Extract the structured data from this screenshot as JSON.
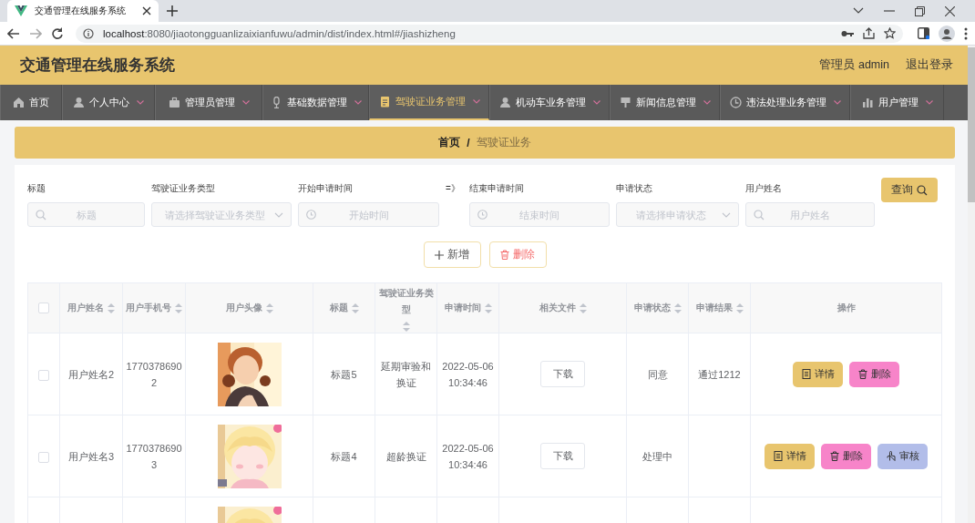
{
  "browser": {
    "tab_title": "交通管理在线服务系统",
    "url_host": "localhost",
    "url_rest": ":8080/jiaotongguanlizaixianfuwu/admin/dist/index.html#/jiashizheng"
  },
  "header": {
    "title": "交通管理在线服务系统",
    "user": "管理员 admin",
    "logout": "退出登录"
  },
  "nav": [
    {
      "label": "首页",
      "selected": false,
      "has_menu": false
    },
    {
      "label": "个人中心",
      "selected": false,
      "has_menu": true
    },
    {
      "label": "管理员管理",
      "selected": false,
      "has_menu": true
    },
    {
      "label": "基础数据管理",
      "selected": false,
      "has_menu": true
    },
    {
      "label": "驾驶证业务管理",
      "selected": true,
      "has_menu": true
    },
    {
      "label": "机动车业务管理",
      "selected": false,
      "has_menu": true
    },
    {
      "label": "新闻信息管理",
      "selected": false,
      "has_menu": true
    },
    {
      "label": "违法处理业务管理",
      "selected": false,
      "has_menu": true
    },
    {
      "label": "用户管理",
      "selected": false,
      "has_menu": true
    }
  ],
  "breadcrumb": [
    {
      "label": "首页",
      "current": false
    },
    {
      "label": "驾驶证业务",
      "current": true
    }
  ],
  "breadcrumb_separator": "/",
  "filters": [
    {
      "kind": "search",
      "label": "标题",
      "placeholder": "标题"
    },
    {
      "kind": "select",
      "label": "驾驶证业务类型",
      "placeholder": "请选择驾驶证业务类型"
    },
    {
      "kind": "date",
      "label": "开始申请时间",
      "placeholder": "开始时间"
    },
    {
      "kind": "arrow",
      "label": "=》"
    },
    {
      "kind": "date",
      "label": "结束申请时间",
      "placeholder": "结束时间"
    },
    {
      "kind": "select",
      "label": "申请状态",
      "placeholder": "请选择申请状态"
    },
    {
      "kind": "search",
      "label": "用户姓名",
      "placeholder": "用户姓名"
    }
  ],
  "query_button": "查询",
  "actions": [
    {
      "kind": "add",
      "label": "新增"
    },
    {
      "kind": "delete",
      "label": "删除"
    }
  ],
  "table": {
    "select_all": {
      "checked": false
    },
    "columns": [
      {
        "label": "用户姓名",
        "sortable": true
      },
      {
        "label": "用户手机号",
        "sortable": true
      },
      {
        "label": "用户头像",
        "sortable": true
      },
      {
        "label": "标题",
        "sortable": true
      },
      {
        "label": "驾驶证业务类型",
        "sortable": true
      },
      {
        "label": "申请时间",
        "sortable": true
      },
      {
        "label": "相关文件",
        "sortable": true
      },
      {
        "label": "申请状态",
        "sortable": true
      },
      {
        "label": "申请结果",
        "sortable": true
      },
      {
        "label": "操作",
        "sortable": false
      }
    ],
    "rows": [
      {
        "kind": "full",
        "checked": false,
        "name": "用户姓名2",
        "phone": "17703786902",
        "avatar": {
          "kind": "picture"
        },
        "title": "标题5",
        "type": "延期审验和换证",
        "time": "2022-05-06 10:34:46",
        "file_button": "下载",
        "status": "同意",
        "result": "通过1212",
        "buttons": [
          {
            "kind": "detail",
            "label": "详情"
          },
          {
            "kind": "delete",
            "label": "删除"
          }
        ]
      },
      {
        "kind": "full",
        "checked": false,
        "name": "用户姓名3",
        "phone": "17703786903",
        "avatar": {
          "kind": "picture"
        },
        "title": "标题4",
        "type": "超龄换证",
        "time": "2022-05-06 10:34:46",
        "file_button": "下载",
        "status": "处理中",
        "buttons": [
          {
            "kind": "detail",
            "label": "详情"
          },
          {
            "kind": "delete",
            "label": "删除"
          },
          {
            "kind": "review",
            "label": "审核"
          }
        ]
      },
      {
        "kind": "cut",
        "avatar": {
          "kind": "picture"
        }
      }
    ]
  }
}
